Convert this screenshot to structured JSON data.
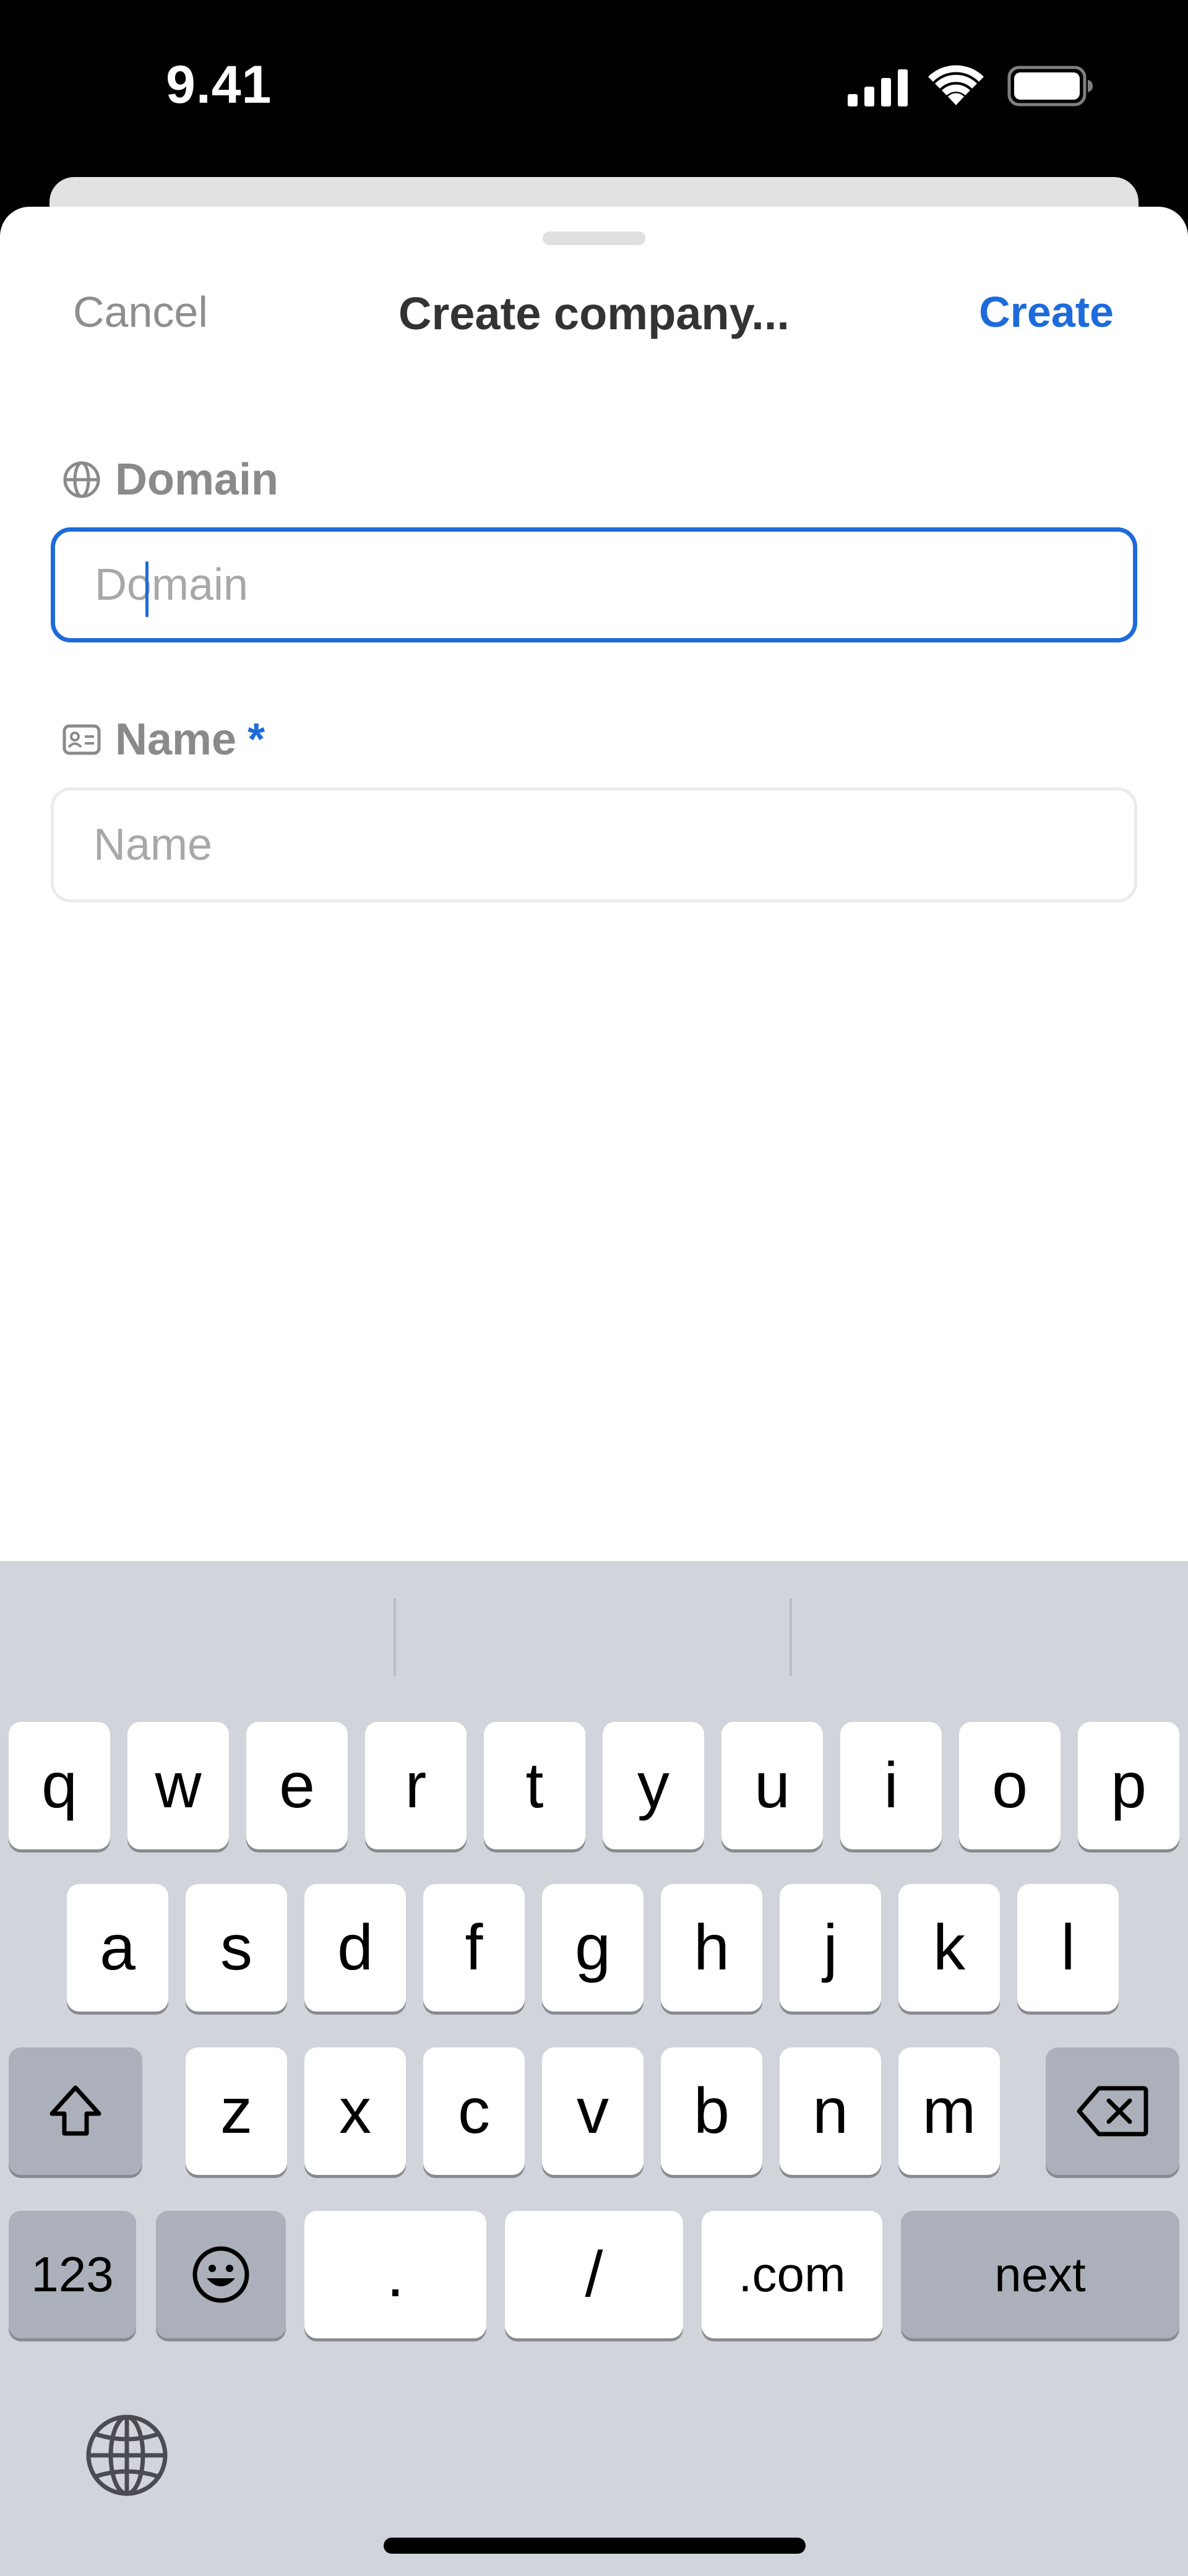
{
  "status_bar": {
    "time": "9.41",
    "icons": [
      "signal-icon",
      "wifi-icon",
      "battery-icon"
    ]
  },
  "sheet": {
    "cancel_label": "Cancel",
    "title": "Create company...",
    "create_label": "Create",
    "fields": [
      {
        "icon": "globe-icon",
        "label": "Domain",
        "placeholder": "Domain",
        "value": "",
        "required": false,
        "focused": true
      },
      {
        "icon": "id-card-icon",
        "label": "Name",
        "required_mark": "*",
        "placeholder": "Name",
        "value": "",
        "required": true,
        "focused": false
      }
    ]
  },
  "keyboard": {
    "row1": [
      "q",
      "w",
      "e",
      "r",
      "t",
      "y",
      "u",
      "i",
      "o",
      "p"
    ],
    "row2": [
      "a",
      "s",
      "d",
      "f",
      "g",
      "h",
      "j",
      "k",
      "l"
    ],
    "row3": [
      "z",
      "x",
      "c",
      "v",
      "b",
      "n",
      "m"
    ],
    "row3_icons": [
      "shift-icon",
      "backspace-icon"
    ],
    "bottom": {
      "numbers": "123",
      "emoji_icon": "emoji-icon",
      "dot": ".",
      "slash": "/",
      "dotcom": ".com",
      "next": "next"
    },
    "globe_icon": "globe-icon"
  },
  "colors": {
    "accent": "#1d6bdb",
    "keyboard_bg": "#d1d4db",
    "key_bg": "#ffffff",
    "dark_key_bg": "#abb0ba"
  }
}
